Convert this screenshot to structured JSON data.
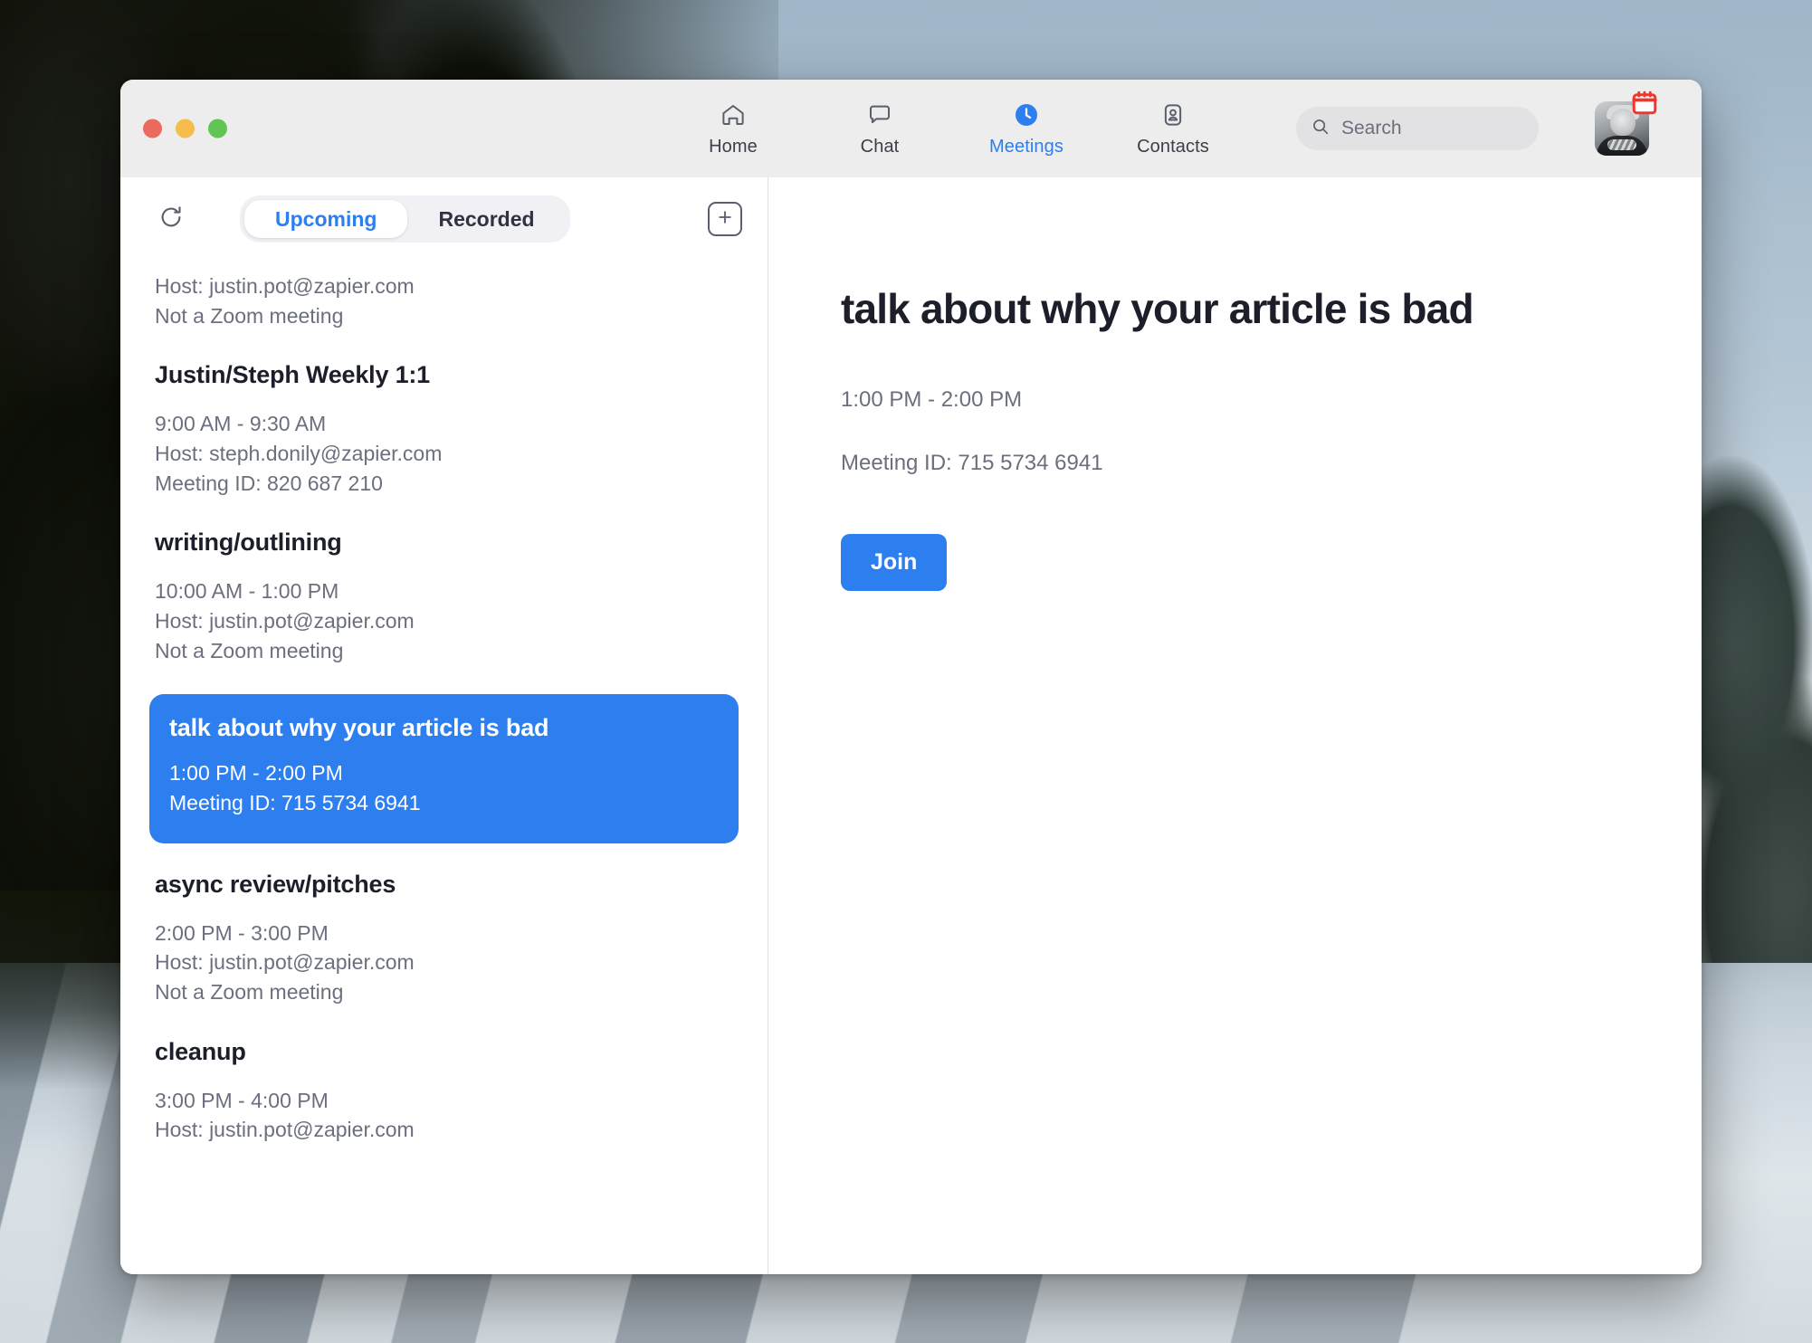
{
  "window": {
    "traffic_lights": [
      "close",
      "minimize",
      "zoom"
    ],
    "colors": {
      "accent": "#2d7ff0",
      "titlebar_bg": "#ededee",
      "badge_red": "#f4352c",
      "muted_text": "#6b6f7e",
      "title_text": "#1c1f2a"
    }
  },
  "nav": {
    "items": [
      {
        "label": "Home",
        "icon": "home-icon",
        "active": false
      },
      {
        "label": "Chat",
        "icon": "chat-icon",
        "active": false
      },
      {
        "label": "Meetings",
        "icon": "clock-icon",
        "active": true
      },
      {
        "label": "Contacts",
        "icon": "contacts-icon",
        "active": false
      }
    ],
    "search": {
      "placeholder": "Search",
      "value": ""
    },
    "avatar": {
      "badge": "calendar-badge"
    }
  },
  "sidebar": {
    "refresh_label": "Refresh",
    "add_label": "Add",
    "tabs": [
      {
        "label": "Upcoming",
        "active": true
      },
      {
        "label": "Recorded",
        "active": false
      }
    ],
    "meetings": [
      {
        "title": "",
        "lines": [
          "Host: justin.pot@zapier.com",
          "Not a Zoom meeting"
        ],
        "selected": false
      },
      {
        "title": "Justin/Steph Weekly 1:1",
        "lines": [
          "9:00 AM - 9:30 AM",
          "Host: steph.donily@zapier.com",
          "Meeting ID: 820 687 210"
        ],
        "selected": false
      },
      {
        "title": "writing/outlining",
        "lines": [
          "10:00 AM - 1:00 PM",
          "Host: justin.pot@zapier.com",
          "Not a Zoom meeting"
        ],
        "selected": false
      },
      {
        "title": "talk about why your article is bad",
        "lines": [
          "1:00 PM - 2:00 PM",
          "Meeting ID: 715 5734 6941"
        ],
        "selected": true
      },
      {
        "title": "async review/pitches",
        "lines": [
          "2:00 PM - 3:00 PM",
          "Host: justin.pot@zapier.com",
          "Not a Zoom meeting"
        ],
        "selected": false
      },
      {
        "title": "cleanup",
        "lines": [
          "3:00 PM - 4:00 PM",
          "Host: justin.pot@zapier.com"
        ],
        "selected": false
      }
    ]
  },
  "detail": {
    "title": "talk about why your article is bad",
    "time": "1:00 PM - 2:00 PM",
    "meeting_id": "Meeting ID: 715 5734 6941",
    "join_label": "Join"
  }
}
